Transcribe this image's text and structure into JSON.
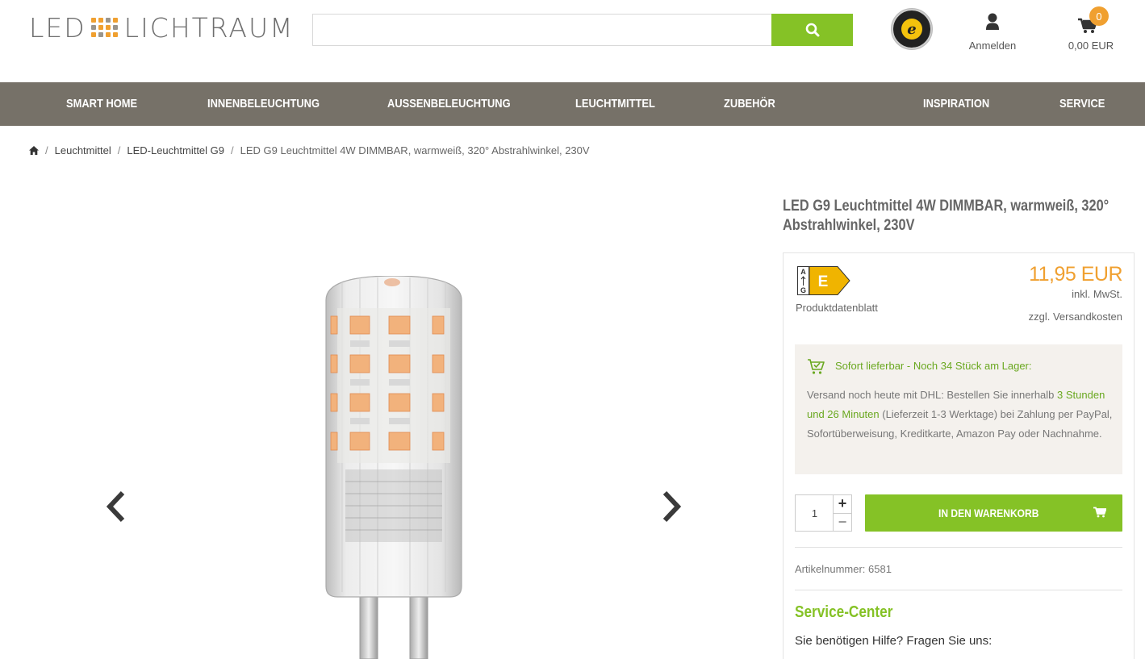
{
  "header": {
    "logo_left": "LED",
    "logo_right": "LICHTRAUM",
    "logo_dot_colors": [
      "#f0a030",
      "#f0a030",
      "#9a958c",
      "#f0a030",
      "#9a958c",
      "#f0a030",
      "#f0a030",
      "#9a958c",
      "#f0a030",
      "#9a958c",
      "#f0a030",
      "#f0a030"
    ],
    "search_placeholder": "",
    "search_value": "",
    "trusted_label": "TRUSTED SHOPS GUARANTEE",
    "login_label": "Anmelden",
    "cart_count": "0",
    "cart_total": "0,00 EUR"
  },
  "nav": {
    "items": [
      {
        "label": "SMART HOME"
      },
      {
        "label": "INNENBELEUCHTUNG"
      },
      {
        "label": "AUSSENBELEUCHTUNG"
      },
      {
        "label": "LEUCHTMITTEL"
      },
      {
        "label": "ZUBEHÖR"
      },
      {
        "label": "INSPIRATION"
      },
      {
        "label": "SERVICE"
      }
    ]
  },
  "breadcrumb": {
    "items": [
      "Leuchtmittel",
      "LED-Leuchtmittel G9"
    ],
    "current": "LED G9 Leuchtmittel 4W DIMMBAR, warmweiß, 320° Abstrahlwinkel, 230V",
    "separator": "/"
  },
  "product": {
    "title": "LED G9 Leuchtmittel 4W DIMMBAR, warmweiß, 320° Abstrahlwinkel, 230V",
    "energy_class": "E",
    "energy_scale_top": "A",
    "energy_scale_bottom": "G",
    "datasheet_label": "Produktdatenblatt",
    "price": "11,95 EUR",
    "tax_note": "inkl. MwSt.",
    "shipping_note": "zzgl. Versandkosten",
    "stock_title": "Sofort lieferbar - Noch 34 Stück am Lager:",
    "stock_text_1": "Versand noch heute mit DHL: Bestellen Sie innerhalb ",
    "stock_time": "3 Stunden und 26 Minuten",
    "stock_text_2": " (Lieferzeit 1-3 Werktage) bei Zahlung per PayPal, Sofortüberweisung, Kreditkarte, Amazon Pay oder Nachnahme.",
    "quantity": "1",
    "qty_plus": "+",
    "qty_minus": "−",
    "add_to_cart": "IN DEN WARENKORB",
    "article_number": "Artikelnummer: 6581",
    "service_title": "Service-Center",
    "service_text": "Sie benötigen Hilfe? Fragen Sie uns:"
  },
  "colors": {
    "accent_green": "#85c226",
    "price_orange": "#f0a030",
    "nav_bg": "#767168",
    "energy_yellow": "#f0b400"
  }
}
